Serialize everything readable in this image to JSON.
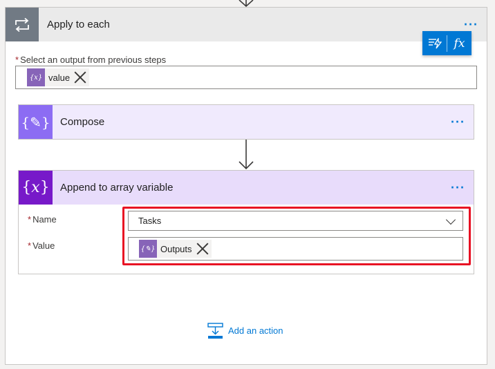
{
  "loop": {
    "title": "Apply to each",
    "select_label": "Select an output from previous steps",
    "required_mark": "*",
    "token": {
      "label": "value",
      "icon": "expression-token-icon"
    }
  },
  "dynamic_panel": {
    "dynamic_content_icon": "dynamic-content-icon",
    "expression_label": "fx"
  },
  "menu_label": "···",
  "compose": {
    "title": "Compose",
    "icon": "compose-icon"
  },
  "append": {
    "title": "Append to array variable",
    "icon": "variable-icon",
    "name_label": "Name",
    "name_value": "Tasks",
    "value_label": "Value",
    "value_token": "Outputs"
  },
  "add_action": {
    "label": "Add an action"
  },
  "colors": {
    "accent": "#0078d4",
    "highlight": "#e81123",
    "compose": "#8c6cf3",
    "variable": "#7719c9"
  }
}
